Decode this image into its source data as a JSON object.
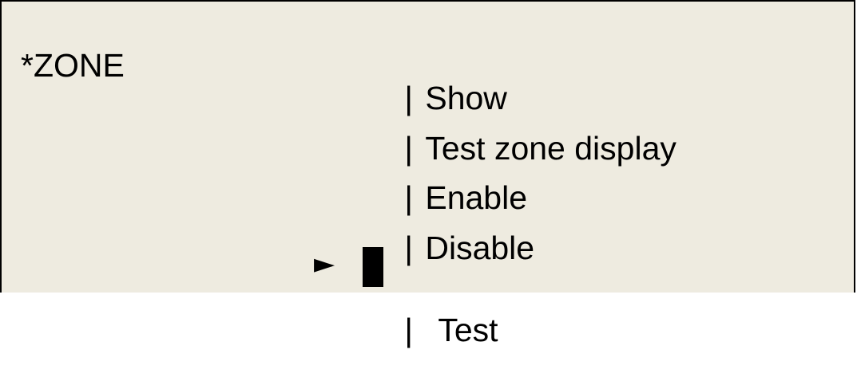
{
  "screen": {
    "title": "*ZONE",
    "separator": "|",
    "pointer_glyph": "►",
    "menu": [
      {
        "label": "Show",
        "selected": false
      },
      {
        "label": "Test zone display",
        "selected": false
      },
      {
        "label": "Enable",
        "selected": false
      },
      {
        "label": "Disable",
        "selected": false
      },
      {
        "label": "Test",
        "selected": true
      }
    ]
  },
  "colors": {
    "background": "#eeebe0",
    "text": "#000000"
  }
}
